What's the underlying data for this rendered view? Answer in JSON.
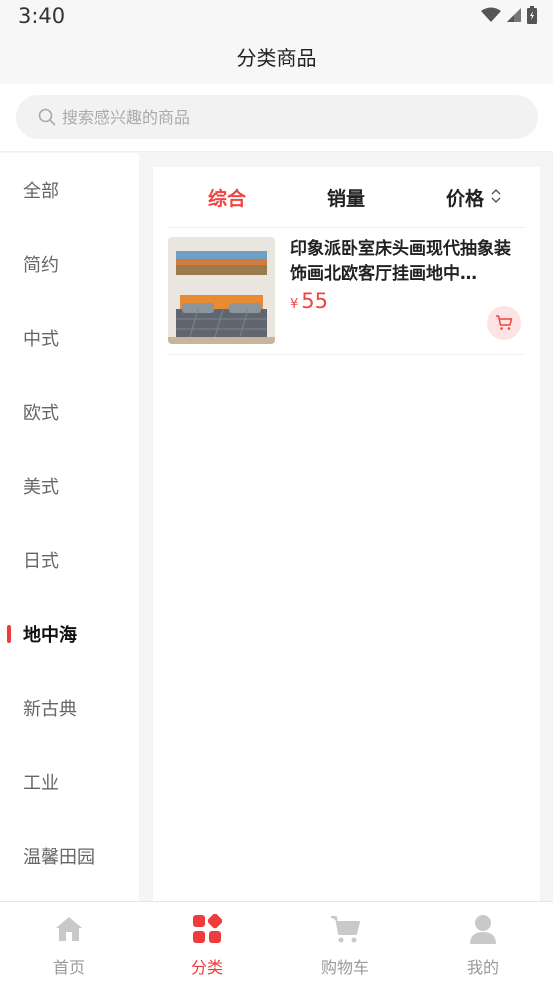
{
  "status_bar": {
    "time": "3:40"
  },
  "header": {
    "title": "分类商品"
  },
  "search": {
    "placeholder": "搜索感兴趣的商品"
  },
  "sidebar": {
    "items": [
      {
        "label": "全部",
        "active": false
      },
      {
        "label": "简约",
        "active": false
      },
      {
        "label": "中式",
        "active": false
      },
      {
        "label": "欧式",
        "active": false
      },
      {
        "label": "美式",
        "active": false
      },
      {
        "label": "日式",
        "active": false
      },
      {
        "label": "地中海",
        "active": true
      },
      {
        "label": "新古典",
        "active": false
      },
      {
        "label": "工业",
        "active": false
      },
      {
        "label": "温馨田园",
        "active": false
      }
    ]
  },
  "sort": {
    "options": [
      "综合",
      "销量",
      "价格"
    ],
    "active": "综合"
  },
  "products": [
    {
      "title": "印象派卧室床头画现代抽象装饰画北欧客厅挂画地中…",
      "currency": "¥",
      "price": "55"
    }
  ],
  "tabbar": {
    "items": [
      {
        "label": "首页",
        "icon": "home-icon",
        "active": false
      },
      {
        "label": "分类",
        "icon": "category-icon",
        "active": true
      },
      {
        "label": "购物车",
        "icon": "cart-icon",
        "active": false
      },
      {
        "label": "我的",
        "icon": "user-icon",
        "active": false
      }
    ]
  },
  "colors": {
    "accent": "#ee3b3b",
    "price": "#ee4444",
    "inactive": "#999999"
  }
}
